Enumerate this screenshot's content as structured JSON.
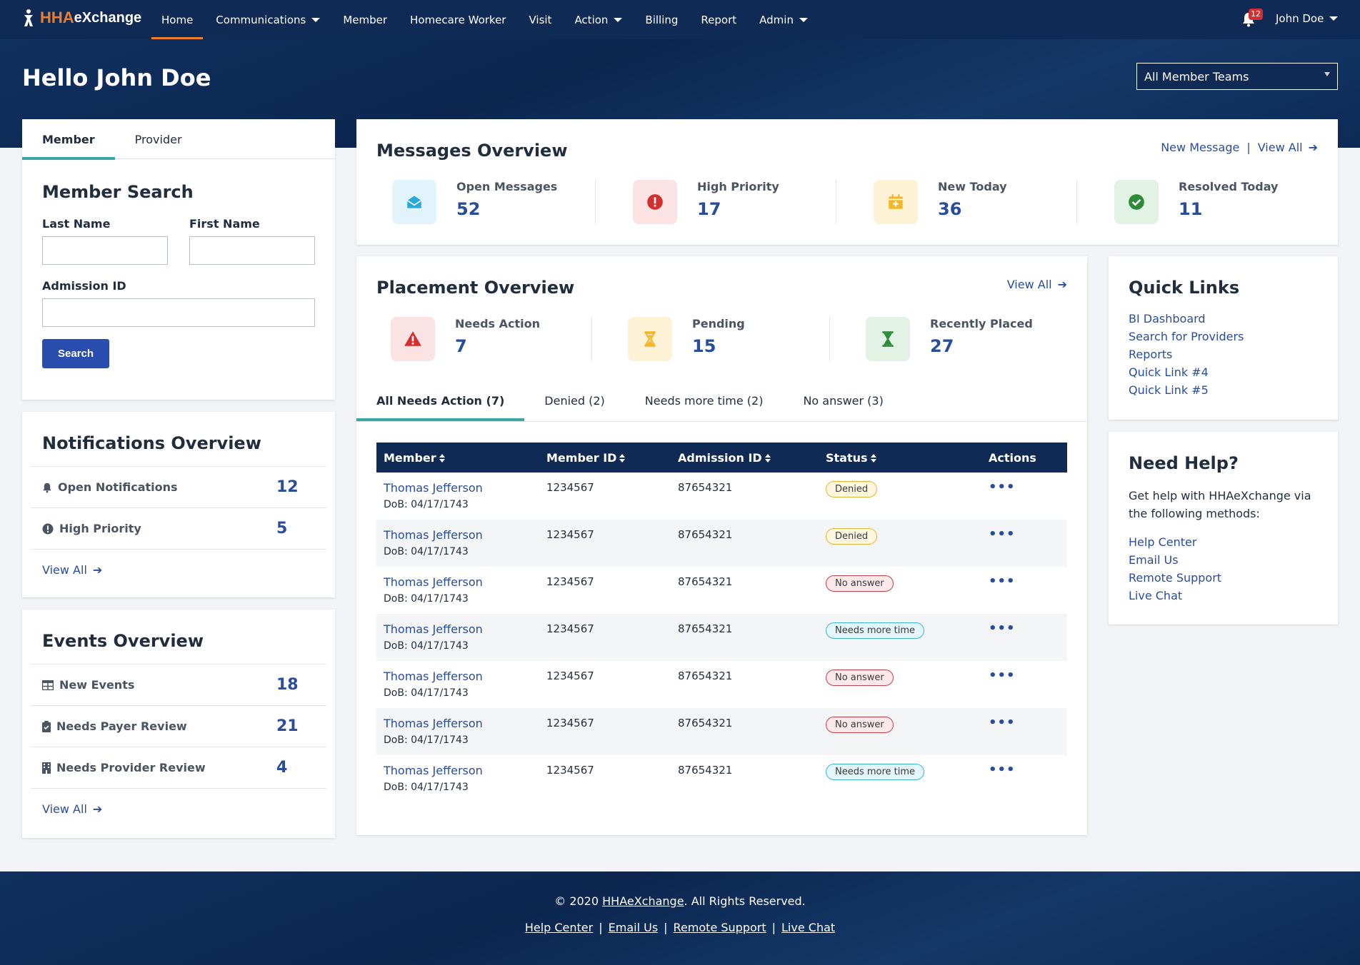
{
  "app": {
    "logo_hha": "HHA",
    "logo_rest": "eXchange"
  },
  "nav": {
    "items": [
      {
        "label": "Home",
        "dropdown": false
      },
      {
        "label": "Communications",
        "dropdown": true
      },
      {
        "label": "Member",
        "dropdown": false
      },
      {
        "label": "Homecare Worker",
        "dropdown": false
      },
      {
        "label": "Visit",
        "dropdown": false
      },
      {
        "label": "Action",
        "dropdown": true
      },
      {
        "label": "Billing",
        "dropdown": false
      },
      {
        "label": "Report",
        "dropdown": false
      },
      {
        "label": "Admin",
        "dropdown": true
      }
    ],
    "notification_count": "12",
    "user_name": "John Doe"
  },
  "header": {
    "greeting": "Hello John Doe",
    "team_select": "All Member Teams"
  },
  "member_search": {
    "tabs": [
      "Member",
      "Provider"
    ],
    "title": "Member Search",
    "last_name_label": "Last Name",
    "first_name_label": "First Name",
    "admission_id_label": "Admission ID",
    "last_name_value": "",
    "first_name_value": "",
    "admission_id_value": "",
    "search_button": "Search"
  },
  "notifications": {
    "title": "Notifications Overview",
    "rows": [
      {
        "label": "Open Notifications",
        "count": "12",
        "icon": "bell-icon"
      },
      {
        "label": "High Priority",
        "count": "5",
        "icon": "exclamation-circle-icon"
      }
    ],
    "view_all": "View All"
  },
  "events": {
    "title": "Events Overview",
    "rows": [
      {
        "label": "New Events",
        "count": "18",
        "icon": "table-icon"
      },
      {
        "label": "Needs Payer Review",
        "count": "21",
        "icon": "clipboard-check-icon"
      },
      {
        "label": "Needs Provider Review",
        "count": "4",
        "icon": "building-icon"
      }
    ],
    "view_all": "View All"
  },
  "messages": {
    "title": "Messages Overview",
    "new_message": "New Message",
    "divider": "|",
    "view_all": "View All",
    "stats": [
      {
        "label": "Open Messages",
        "value": "52",
        "icon": "envelope-open-icon",
        "color": "#2aa8dc",
        "bg": "#e2f4fb"
      },
      {
        "label": "High Priority",
        "value": "17",
        "icon": "exclamation-circle-icon",
        "color": "#d32f2f",
        "bg": "#fbe3e4"
      },
      {
        "label": "New Today",
        "value": "36",
        "icon": "calendar-plus-icon",
        "color": "#f3b728",
        "bg": "#fdf1d6"
      },
      {
        "label": "Resolved Today",
        "value": "11",
        "icon": "check-circle-icon",
        "color": "#2e8b3a",
        "bg": "#e2f2e4"
      }
    ]
  },
  "placement": {
    "title": "Placement Overview",
    "view_all": "View All",
    "stats": [
      {
        "label": "Needs Action",
        "value": "7",
        "icon": "warning-triangle-icon",
        "color": "#d32f2f",
        "bg": "#fbe3e4"
      },
      {
        "label": "Pending",
        "value": "15",
        "icon": "hourglass-half-icon",
        "color": "#f3b728",
        "bg": "#fdf1d6"
      },
      {
        "label": "Recently Placed",
        "value": "27",
        "icon": "hourglass-end-icon",
        "color": "#2e8b3a",
        "bg": "#e2f2e4"
      }
    ],
    "tabs": [
      "All Needs Action (7)",
      "Denied (2)",
      "Needs more time (2)",
      "No answer (3)"
    ],
    "columns": [
      "Member",
      "Member ID",
      "Admission ID",
      "Status",
      "Actions"
    ],
    "rows": [
      {
        "name": "Thomas Jefferson",
        "dob": "DoB: 04/17/1743",
        "member_id": "1234567",
        "admission_id": "87654321",
        "status": "Denied",
        "status_kind": "denied"
      },
      {
        "name": "Thomas Jefferson",
        "dob": "DoB: 04/17/1743",
        "member_id": "1234567",
        "admission_id": "87654321",
        "status": "Denied",
        "status_kind": "denied"
      },
      {
        "name": "Thomas Jefferson",
        "dob": "DoB: 04/17/1743",
        "member_id": "1234567",
        "admission_id": "87654321",
        "status": "No answer",
        "status_kind": "noanswer"
      },
      {
        "name": "Thomas Jefferson",
        "dob": "DoB: 04/17/1743",
        "member_id": "1234567",
        "admission_id": "87654321",
        "status": "Needs more time",
        "status_kind": "needsmore"
      },
      {
        "name": "Thomas Jefferson",
        "dob": "DoB: 04/17/1743",
        "member_id": "1234567",
        "admission_id": "87654321",
        "status": "No answer",
        "status_kind": "noanswer"
      },
      {
        "name": "Thomas Jefferson",
        "dob": "DoB: 04/17/1743",
        "member_id": "1234567",
        "admission_id": "87654321",
        "status": "No answer",
        "status_kind": "noanswer"
      },
      {
        "name": "Thomas Jefferson",
        "dob": "DoB: 04/17/1743",
        "member_id": "1234567",
        "admission_id": "87654321",
        "status": "Needs more time",
        "status_kind": "needsmore"
      }
    ],
    "actions_glyph": "•••"
  },
  "quick_links": {
    "title": "Quick Links",
    "links": [
      "BI Dashboard",
      "Search for Providers",
      "Reports",
      "Quick Link #4",
      "Quick Link #5"
    ]
  },
  "help": {
    "title": "Need Help?",
    "text": "Get help with HHAeXchange via the following methods:",
    "links": [
      "Help Center",
      "Email Us",
      "Remote Support",
      "Live Chat"
    ]
  },
  "footer": {
    "copy_prefix": "© 2020 ",
    "copy_link": "HHAeXchange",
    "copy_suffix": ". All Rights Reserved.",
    "links": [
      "Help Center",
      "Email Us",
      "Remote Support",
      "Live Chat"
    ],
    "separator": "|"
  }
}
